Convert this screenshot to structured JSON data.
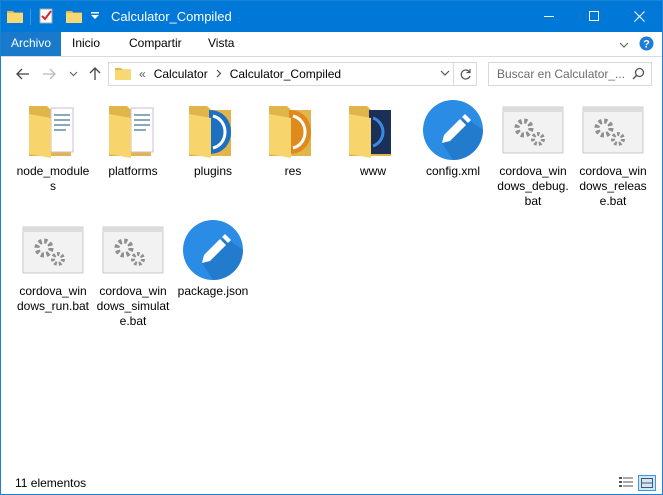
{
  "window": {
    "title": "Calculator_Compiled",
    "accent": "#0078d7",
    "quick_access": [
      "folder-icon",
      "properties-icon",
      "new-folder-icon",
      "customize-dropdown-icon"
    ]
  },
  "ribbon": {
    "tabs": [
      {
        "label": "Archivo",
        "active": true
      },
      {
        "label": "Inicio"
      },
      {
        "label": "Compartir"
      },
      {
        "label": "Vista"
      }
    ]
  },
  "address": {
    "overflow": "«",
    "crumbs": [
      "Calculator",
      "Calculator_Compiled"
    ]
  },
  "search": {
    "placeholder": "Buscar en Calculator_..."
  },
  "items": [
    {
      "label": "node_modules",
      "icon": "folder-docs-icon"
    },
    {
      "label": "platforms",
      "icon": "folder-docs-icon"
    },
    {
      "label": "plugins",
      "icon": "folder-blue-icon"
    },
    {
      "label": "res",
      "icon": "folder-orange-icon"
    },
    {
      "label": "www",
      "icon": "folder-app-icon"
    },
    {
      "label": "config.xml",
      "icon": "edit-circle-icon"
    },
    {
      "label": "cordova_windows_debug.bat",
      "icon": "gears-bat-icon"
    },
    {
      "label": "cordova_windows_release.bat",
      "icon": "gears-bat-icon"
    },
    {
      "label": "cordova_windows_run.bat",
      "icon": "gears-bat-icon"
    },
    {
      "label": "cordova_windows_simulate.bat",
      "icon": "gears-bat-icon"
    },
    {
      "label": "package.json",
      "icon": "edit-circle-icon"
    }
  ],
  "status": {
    "count_text": "11 elementos",
    "view": "large-icons"
  }
}
